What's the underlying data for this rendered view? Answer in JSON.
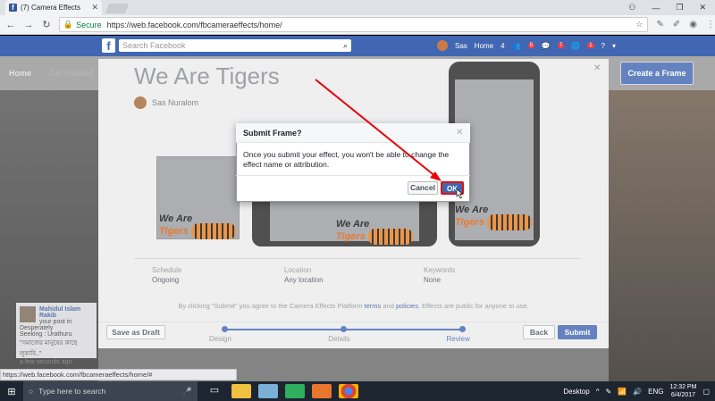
{
  "browser": {
    "tab_title": "(7) Camera Effects",
    "secure_label": "Secure",
    "url": "https://web.facebook.com/fbcameraeffects/home/",
    "status_url": "https://web.facebook.com/fbcameraeffects/home/#"
  },
  "fbbar": {
    "search_placeholder": "Search Facebook",
    "user_name": "Sas",
    "home_label": "Home",
    "home_count": "4",
    "badge1": "5",
    "badge2": "7",
    "badge3": "1"
  },
  "subnav": {
    "home": "Home",
    "get_inspired": "Get Inspired"
  },
  "create_frame_label": "Create a Frame",
  "notification": {
    "name": "Mahidul Islam Rakib",
    "line1": "your post in Desperately",
    "line2": "Seeking : Urathuru",
    "line3": "\"সমাজের মানুষের কাছে",
    "line4": "লুকাবি..\"",
    "time": "a few seconds ago"
  },
  "frame_dialog": {
    "title": "We Are Tigers",
    "author": "Sas Nuralom",
    "frame_text_1": "We Are",
    "frame_text_2": "Tigers",
    "schedule_label": "Schedule",
    "schedule_value": "Ongoing",
    "location_label": "Location",
    "location_value": "Any location",
    "keywords_label": "Keywords",
    "keywords_value": "None",
    "legal_pre": "By clicking \"Submit\" you agree to the Camera Effects Platform",
    "legal_terms": "terms",
    "legal_and": "and",
    "legal_policies": "policies",
    "legal_post": ". Effects are public for anyone to use.",
    "save_draft": "Save as Draft",
    "step_design": "Design",
    "step_details": "Details",
    "step_review": "Review",
    "back": "Back",
    "submit": "Submit"
  },
  "confirm_modal": {
    "title": "Submit Frame?",
    "body": "Once you submit your effect, you won't be able to change the effect name or attribution.",
    "cancel": "Cancel",
    "ok": "OK"
  },
  "taskbar": {
    "search_placeholder": "Type here to search",
    "desktop_label": "Desktop",
    "lang": "ENG",
    "time": "12:32 PM",
    "date": "6/4/2017"
  },
  "colors": {
    "fb_blue": "#4267b2",
    "ok_highlight": "#e01010",
    "annotation_arrow": "#e8000b"
  }
}
